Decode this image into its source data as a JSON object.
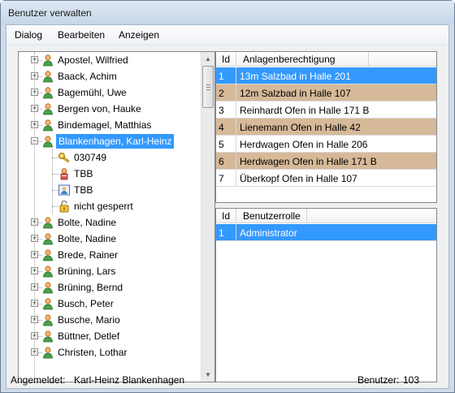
{
  "window": {
    "title": "Benutzer verwalten"
  },
  "menu": [
    "Dialog",
    "Bearbeiten",
    "Anzeigen"
  ],
  "tree": {
    "users_before": [
      "Apostel, Wilfried",
      "Baack, Achim",
      "Bagemühl, Uwe",
      "Bergen von, Hauke",
      "Bindemagel, Matthias"
    ],
    "selected_user": "Blankenhagen, Karl-Heinz",
    "children": [
      {
        "icon": "key-icon",
        "label": "030749"
      },
      {
        "icon": "person-icon",
        "label": "TBB"
      },
      {
        "icon": "photo-icon",
        "label": "TBB"
      },
      {
        "icon": "unlocked-padlock-icon",
        "label": "nicht gesperrt"
      }
    ],
    "users_after": [
      "Bolte, Nadine",
      "Bolte, Nadine",
      "Brede, Rainer",
      "Brüning, Lars",
      "Brüning, Bernd",
      "Busch, Peter",
      "Busche, Mario",
      "Büttner, Detlef",
      "Christen, Lothar"
    ]
  },
  "permissions": {
    "headers": {
      "id": "Id",
      "name": "Anlagenberechtigung"
    },
    "rows": [
      {
        "id": "1",
        "name": "13m Salzbad in Halle 201",
        "state": "selected"
      },
      {
        "id": "2",
        "name": "12m Salzbad in Halle 107",
        "state": "tan"
      },
      {
        "id": "3",
        "name": "Reinhardt Ofen in Halle 171 B",
        "state": "normal"
      },
      {
        "id": "4",
        "name": "Lienemann Ofen in Halle 42",
        "state": "tan"
      },
      {
        "id": "5",
        "name": "Herdwagen Ofen in Halle 206",
        "state": "normal"
      },
      {
        "id": "6",
        "name": "Herdwagen Ofen in Halle 171 B",
        "state": "tan"
      },
      {
        "id": "7",
        "name": "Überkopf Ofen in Halle 107",
        "state": "normal"
      }
    ]
  },
  "roles": {
    "headers": {
      "id": "Id",
      "name": "Benutzerrolle"
    },
    "rows": [
      {
        "id": "1",
        "name": "Administrator",
        "state": "selected"
      }
    ]
  },
  "status": {
    "logged_in_label": "Angemeldet:",
    "logged_in_user": "Karl-Heinz Blankenhagen",
    "users_label": "Benutzer:",
    "users_count": "103"
  },
  "colors": {
    "selection": "#3399ff",
    "tan_row": "#d6b998"
  }
}
